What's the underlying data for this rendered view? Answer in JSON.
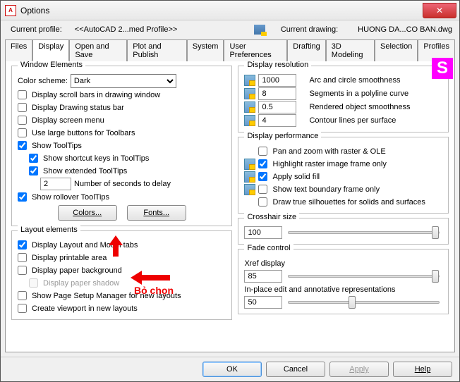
{
  "title": "Options",
  "profile": {
    "label": "Current profile:",
    "value": "<<AutoCAD 2...med Profile>>",
    "drawing_label": "Current drawing:",
    "drawing_value": "HUONG DA...CO BAN.dwg"
  },
  "tabs": [
    "Files",
    "Display",
    "Open and Save",
    "Plot and Publish",
    "System",
    "User Preferences",
    "Drafting",
    "3D Modeling",
    "Selection",
    "Profiles"
  ],
  "active_tab": 1,
  "window_elements": {
    "legend": "Window Elements",
    "color_scheme_label": "Color scheme:",
    "color_scheme_value": "Dark",
    "scrollbars": "Display scroll bars in drawing window",
    "statusbar": "Display Drawing status bar",
    "screenmenu": "Display screen menu",
    "largebuttons": "Use large buttons for Toolbars",
    "tooltips": "Show ToolTips",
    "shortcut": "Show shortcut keys in ToolTips",
    "extended": "Show extended ToolTips",
    "seconds_value": "2",
    "seconds_label": "Number of seconds to delay",
    "rollover": "Show rollover ToolTips",
    "colors_btn": "Colors...",
    "fonts_btn": "Fonts..."
  },
  "layout_elements": {
    "legend": "Layout elements",
    "layout_model": "Display Layout and Model tabs",
    "printable": "Display printable area",
    "paperbg": "Display paper background",
    "papershadow": "Display paper shadow",
    "pagesetup": "Show Page Setup Manager for new layouts",
    "viewport": "Create viewport in new layouts"
  },
  "display_resolution": {
    "legend": "Display resolution",
    "arc_val": "1000",
    "arc_lbl": "Arc and circle smoothness",
    "seg_val": "8",
    "seg_lbl": "Segments in a polyline curve",
    "ren_val": "0.5",
    "ren_lbl": "Rendered object smoothness",
    "con_val": "4",
    "con_lbl": "Contour lines per surface"
  },
  "display_performance": {
    "legend": "Display performance",
    "pan": "Pan and zoom with raster & OLE",
    "highlight": "Highlight raster image frame only",
    "solidfill": "Apply solid fill",
    "textboundary": "Show text boundary frame only",
    "silhouettes": "Draw true silhouettes for solids and surfaces"
  },
  "crosshair": {
    "legend": "Crosshair size",
    "value": "100"
  },
  "fade": {
    "legend": "Fade control",
    "xref_label": "Xref display",
    "xref_value": "85",
    "inplace_label": "In-place edit and annotative representations",
    "inplace_value": "50"
  },
  "buttons": {
    "ok": "OK",
    "cancel": "Cancel",
    "apply": "Apply",
    "help": "Help"
  },
  "annotation": "Bỏ chọn"
}
